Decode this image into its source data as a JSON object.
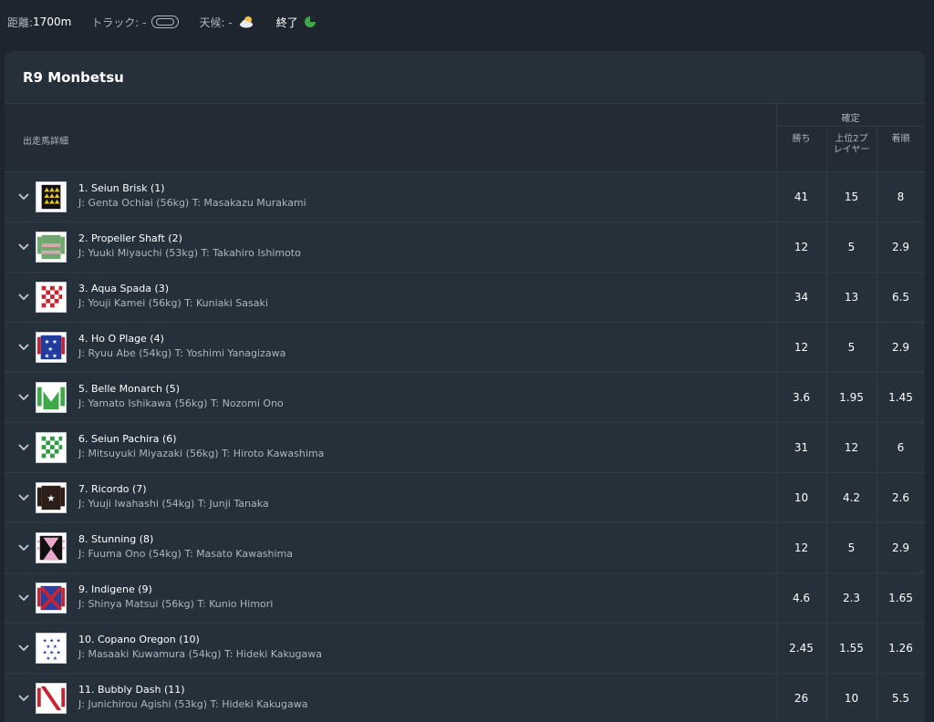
{
  "info": {
    "distance_label": "距離:",
    "distance_value": "1700m",
    "track_label": "トラック: -",
    "weather_label": "天候: -",
    "status_label": "終了"
  },
  "race": {
    "title": "R9 Monbetsu"
  },
  "table": {
    "runners_header": "出走馬詳細",
    "group_header": "確定",
    "col_win": "勝ち",
    "col_top2": "上位2プレイヤー",
    "col_rank": "着順"
  },
  "runners": [
    {
      "name": "1. Seiun Brisk (1)",
      "sub": "J: Genta Ochiai (56kg) T: Masakazu Murakami",
      "win": "41",
      "top2": "15",
      "rank": "8",
      "silk": "yellow-triangles-icon"
    },
    {
      "name": "2. Propeller Shaft (2)",
      "sub": "J: Yuuki Miyauchi (53kg) T: Takahiro Ishimoto",
      "win": "12",
      "top2": "5",
      "rank": "2.9",
      "silk": "green-stripes-icon"
    },
    {
      "name": "3. Aqua Spada (3)",
      "sub": "J: Youji Kamei (56kg) T: Kuniaki Sasaki",
      "win": "34",
      "top2": "13",
      "rank": "6.5",
      "silk": "red-checks-icon"
    },
    {
      "name": "4. Ho O Plage (4)",
      "sub": "J: Ryuu Abe (54kg) T: Yoshimi Yanagizawa",
      "win": "12",
      "top2": "5",
      "rank": "2.9",
      "silk": "blue-stars-icon"
    },
    {
      "name": "5. Belle Monarch (5)",
      "sub": "J: Yamato Ishikawa (56kg) T: Nozomi Ono",
      "win": "3.6",
      "top2": "1.95",
      "rank": "1.45",
      "silk": "green-m-icon"
    },
    {
      "name": "6. Seiun Pachira (6)",
      "sub": "J: Mitsuyuki Miyazaki (56kg) T: Hiroto Kawashima",
      "win": "31",
      "top2": "12",
      "rank": "6",
      "silk": "green-checks-icon"
    },
    {
      "name": "7. Ricordo (7)",
      "sub": "J: Yuuji Iwahashi (54kg) T: Junji Tanaka",
      "win": "10",
      "top2": "4.2",
      "rank": "2.6",
      "silk": "brown-star-icon"
    },
    {
      "name": "8. Stunning (8)",
      "sub": "J: Fuuma Ono (54kg) T: Masato Kawashima",
      "win": "12",
      "top2": "5",
      "rank": "2.9",
      "silk": "pink-black-icon"
    },
    {
      "name": "9. Indigene (9)",
      "sub": "J: Shinya Matsui (56kg) T: Kunio Himori",
      "win": "4.6",
      "top2": "2.3",
      "rank": "1.65",
      "silk": "blue-red-cross-icon"
    },
    {
      "name": "10. Copano Oregon (10)",
      "sub": "J: Masaaki Kuwamura (54kg) T: Hideki Kakugawa",
      "win": "2.45",
      "top2": "1.55",
      "rank": "1.26",
      "silk": "white-blue-stars-icon"
    },
    {
      "name": "11. Bubbly Dash (11)",
      "sub": "J: Junichirou Agishi (53kg) T: Hideki Kakugawa",
      "win": "26",
      "top2": "10",
      "rank": "5.5",
      "silk": "red-sash-icon"
    }
  ]
}
